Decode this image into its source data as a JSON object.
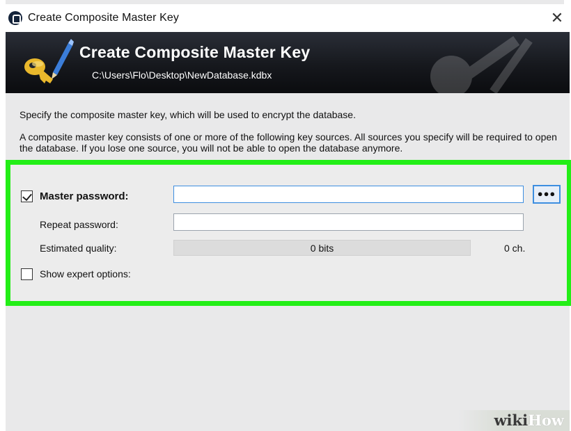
{
  "window": {
    "title": "Create Composite Master Key",
    "close_glyph": "✕"
  },
  "banner": {
    "title": "Create Composite Master Key",
    "path": "C:\\Users\\Flo\\Desktop\\NewDatabase.kdbx"
  },
  "description": {
    "line1": "Specify the composite master key, which will be used to encrypt the database.",
    "line2": "A composite master key consists of one or more of the following key sources. All sources you specify will be required to open the database. If you lose one source, you will not be able to open the database anymore."
  },
  "form": {
    "master_password": {
      "label": "Master password:",
      "checked": true,
      "value": ""
    },
    "show_password_button": "●●●",
    "repeat_password": {
      "label": "Repeat password:",
      "value": ""
    },
    "estimated_quality": {
      "label": "Estimated quality:",
      "bits_text": "0 bits",
      "fraction": 0,
      "chars_text": "0 ch."
    },
    "expert_options": {
      "label": "Show expert options:",
      "checked": false
    }
  },
  "watermark": {
    "part1": "wiki",
    "part2": "How"
  },
  "colors": {
    "highlight_border": "#23ee17",
    "banner_bg": "#16181d",
    "focus_blue": "#3d8ee0"
  }
}
